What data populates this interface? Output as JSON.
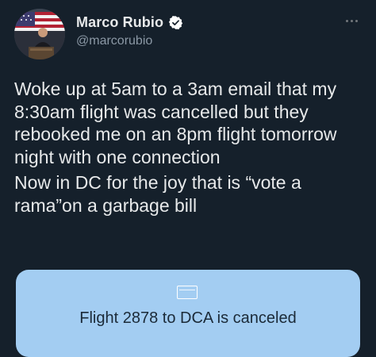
{
  "author": {
    "display_name": "Marco Rubio",
    "handle": "@marcorubio",
    "verified": true,
    "avatar": "flag-backdrop-speaker-avatar"
  },
  "menu": {
    "icon": "more-horizontal-icon"
  },
  "tweet": {
    "paragraph_1": "Woke up at 5am to a 3am email that my 8:30am flight was cancelled but they rebooked me on an 8pm flight tomorrow night with one connection",
    "paragraph_2": "Now in DC for the joy that is “vote a rama”on a garbage bill"
  },
  "card": {
    "icon": "email-icon",
    "title": "Flight 2878 to DCA is canceled",
    "background_color": "#a3cdf2"
  },
  "colors": {
    "background": "#15202b",
    "text": "#e7e9ea",
    "secondary_text": "#8b98a5",
    "verified_badge": "#ffffff"
  }
}
